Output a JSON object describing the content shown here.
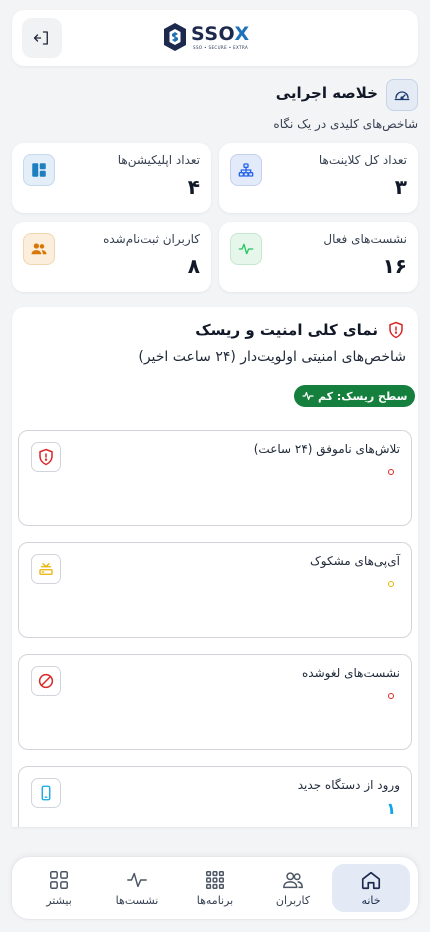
{
  "header": {
    "logo_text": "SSO",
    "logo_x": "X",
    "logo_tagline": "SSO • SECURE • EXTRA"
  },
  "summary": {
    "title": "خلاصه اجرایی",
    "subtitle": "شاخص‌های کلیدی در یک نگاه",
    "icon": "gauge-icon"
  },
  "stats": [
    {
      "label": "تعداد کل کلاینت‌ها",
      "value": "۳",
      "icon": "network-icon",
      "color": "#2563eb"
    },
    {
      "label": "تعداد اپلیکیشن‌ها",
      "value": "۴",
      "icon": "dashboard-icon",
      "color": "#1d7fc0"
    },
    {
      "label": "نشست‌های فعال",
      "value": "۱۶",
      "icon": "activity-icon",
      "color": "#22c55e"
    },
    {
      "label": "کاربران ثبت‌نام‌شده",
      "value": "۸",
      "icon": "users-icon",
      "color": "#d97706"
    }
  ],
  "security": {
    "title": "نمای کلی امنیت و ریسک",
    "subtitle": "شاخص‌های امنیتی اولویت‌دار (۲۴ ساعت اخیر)",
    "risk_badge": "سطح ریسک: کم",
    "metrics": [
      {
        "label": "تلاش‌های ناموفق (۲۴ ساعت)",
        "icon": "shield-alert-icon",
        "color": "#dc2626",
        "value": ""
      },
      {
        "label": "آی‌پی‌های مشکوک",
        "icon": "server-warning-icon",
        "color": "#eab308",
        "value": ""
      },
      {
        "label": "نشست‌های لغوشده",
        "icon": "ban-icon",
        "color": "#dc2626",
        "value": ""
      },
      {
        "label": "ورود از دستگاه جدید",
        "icon": "device-icon",
        "color": "#0ea5e9",
        "value": "۱"
      }
    ]
  },
  "nav": [
    {
      "label": "خانه",
      "icon": "home-icon",
      "active": true
    },
    {
      "label": "کاربران",
      "icon": "users-icon",
      "active": false
    },
    {
      "label": "برنامه‌ها",
      "icon": "apps-grid-icon",
      "active": false
    },
    {
      "label": "نشست‌ها",
      "icon": "activity-icon",
      "active": false
    },
    {
      "label": "بیشتر",
      "icon": "more-grid-icon",
      "active": false
    }
  ],
  "colors": {
    "brand": "#1d2a4d",
    "accent": "#1e73b8",
    "risk_low": "#15803d"
  }
}
